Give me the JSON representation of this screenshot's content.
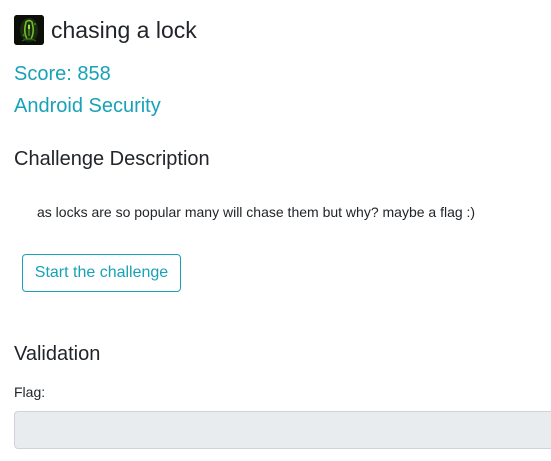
{
  "challenge": {
    "icon": "android-lock-icon",
    "title": "chasing a lock",
    "score": "Score: 858",
    "category": "Android Security"
  },
  "description": {
    "heading": "Challenge Description",
    "text": "as locks are so popular many will chase them but why? maybe a flag :)",
    "start_button_label": "Start the challenge"
  },
  "validation": {
    "heading": "Validation",
    "flag_label": "Flag:",
    "flag_value": "",
    "flag_placeholder": ""
  },
  "colors": {
    "accent": "#17a2b8",
    "text": "#212529",
    "input_background": "#e9ecef",
    "input_border": "#ced4da"
  }
}
